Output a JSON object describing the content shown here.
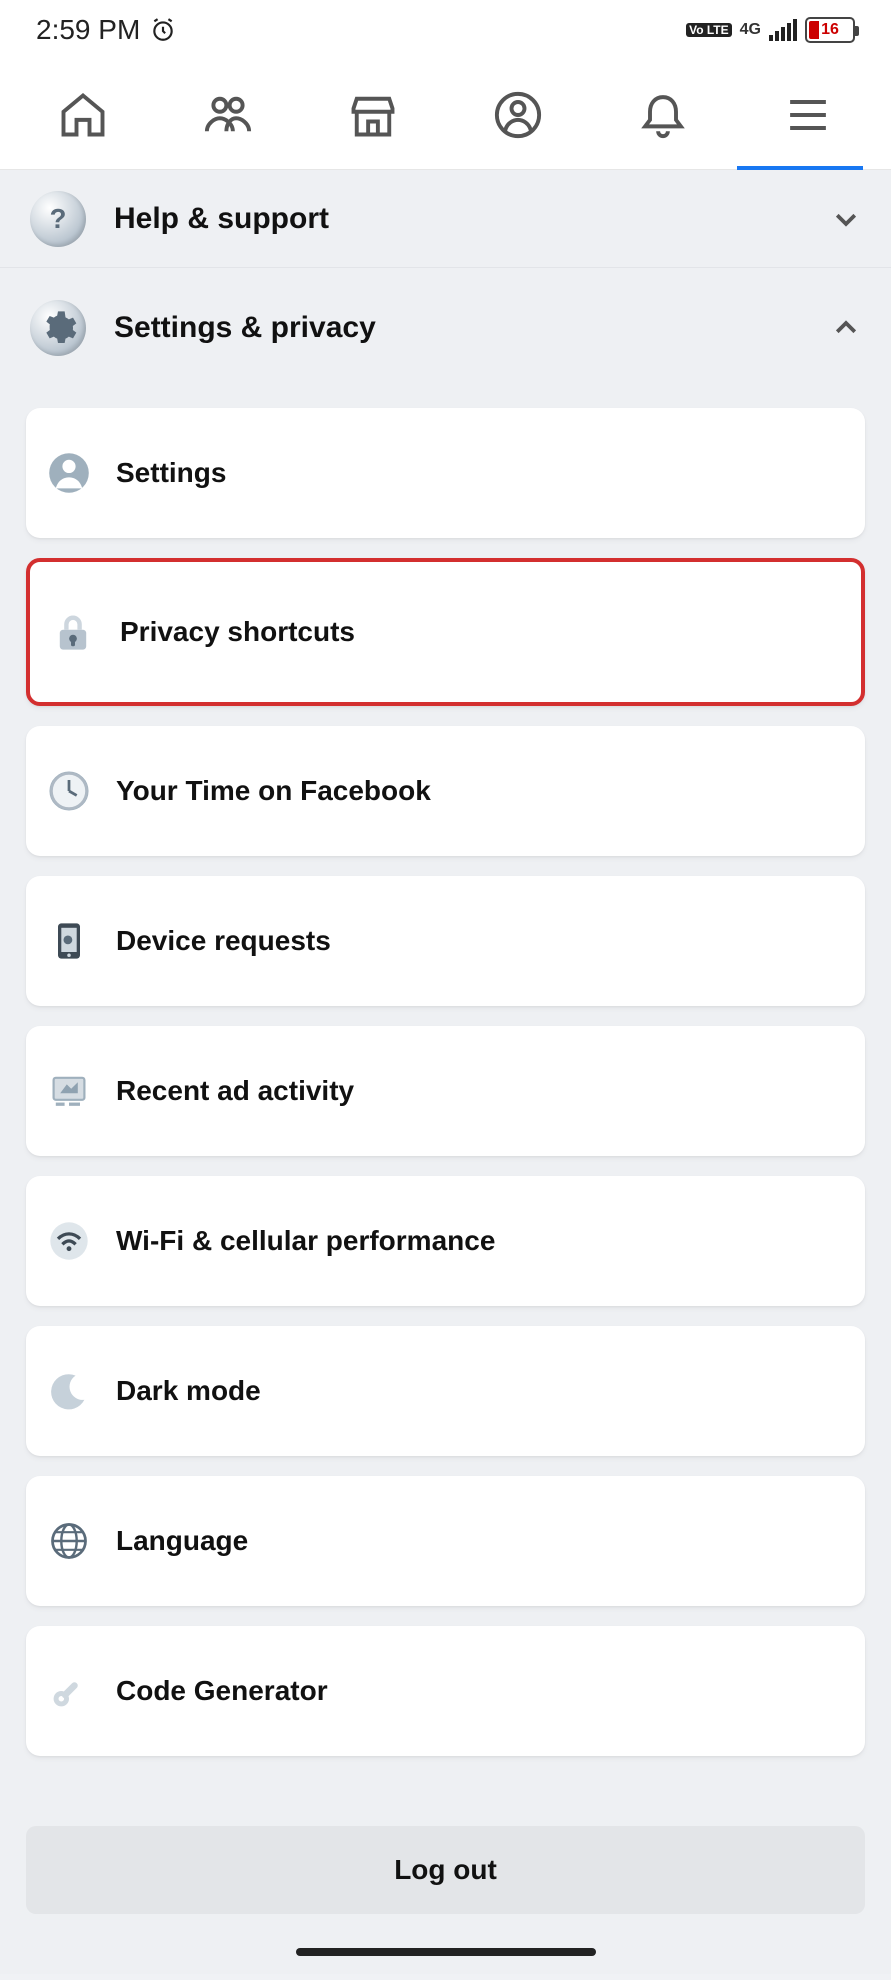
{
  "status": {
    "time": "2:59 PM",
    "network_label": "4G",
    "volte": "Vo LTE",
    "battery_percent": "16"
  },
  "sections": {
    "help_support": {
      "title": "Help & support"
    },
    "settings_privacy": {
      "title": "Settings & privacy"
    }
  },
  "settings_items": [
    {
      "label": "Settings"
    },
    {
      "label": "Privacy shortcuts"
    },
    {
      "label": "Your Time on Facebook"
    },
    {
      "label": "Device requests"
    },
    {
      "label": "Recent ad activity"
    },
    {
      "label": "Wi-Fi & cellular performance"
    },
    {
      "label": "Dark mode"
    },
    {
      "label": "Language"
    },
    {
      "label": "Code Generator"
    }
  ],
  "logout_label": "Log out"
}
